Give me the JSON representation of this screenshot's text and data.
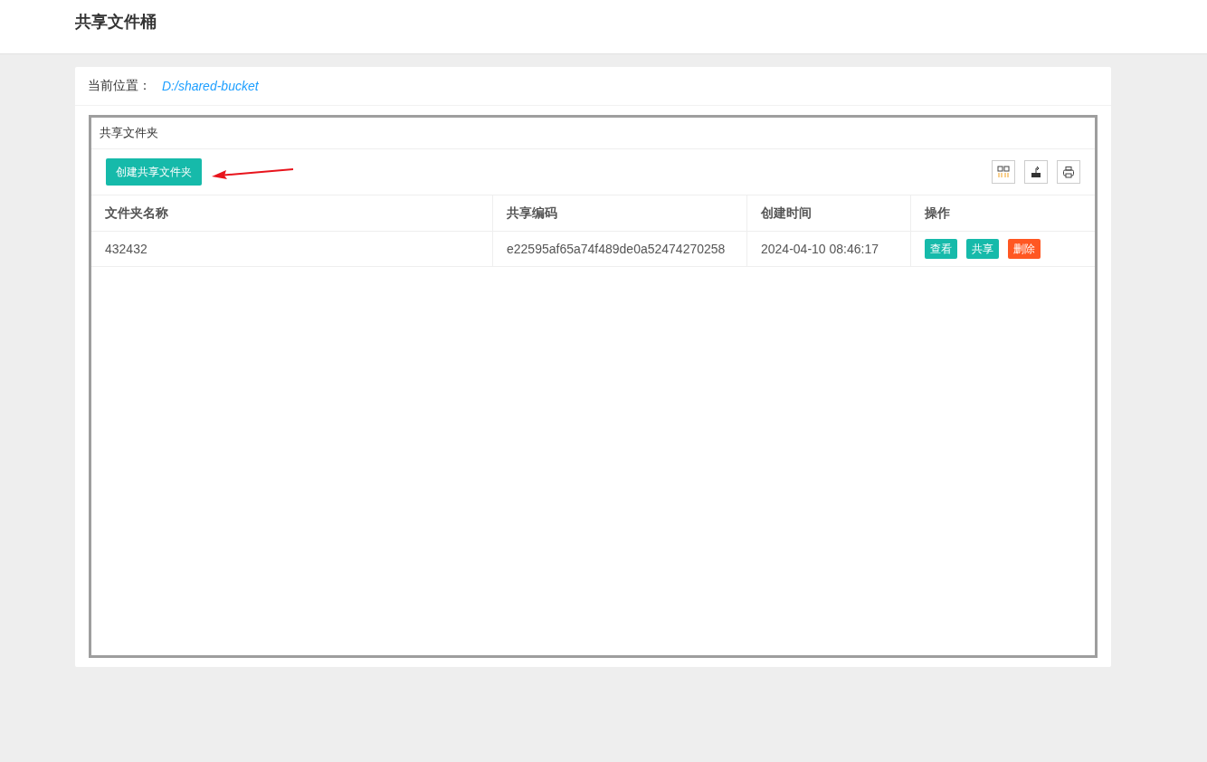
{
  "header": {
    "title": "共享文件桶"
  },
  "location": {
    "label": "当前位置：",
    "path": "D:/shared-bucket"
  },
  "panel": {
    "title": "共享文件夹",
    "create_button": "创建共享文件夹"
  },
  "table": {
    "columns": [
      "文件夹名称",
      "共享编码",
      "创建时间",
      "操作"
    ],
    "rows": [
      {
        "name": "432432",
        "code": "e22595af65a74f489de0a52474270258",
        "created": "2024-04-10 08:46:17",
        "actions": [
          {
            "label": "查看",
            "kind": "normal"
          },
          {
            "label": "共享",
            "kind": "normal"
          },
          {
            "label": "删除",
            "kind": "danger"
          }
        ]
      }
    ]
  }
}
